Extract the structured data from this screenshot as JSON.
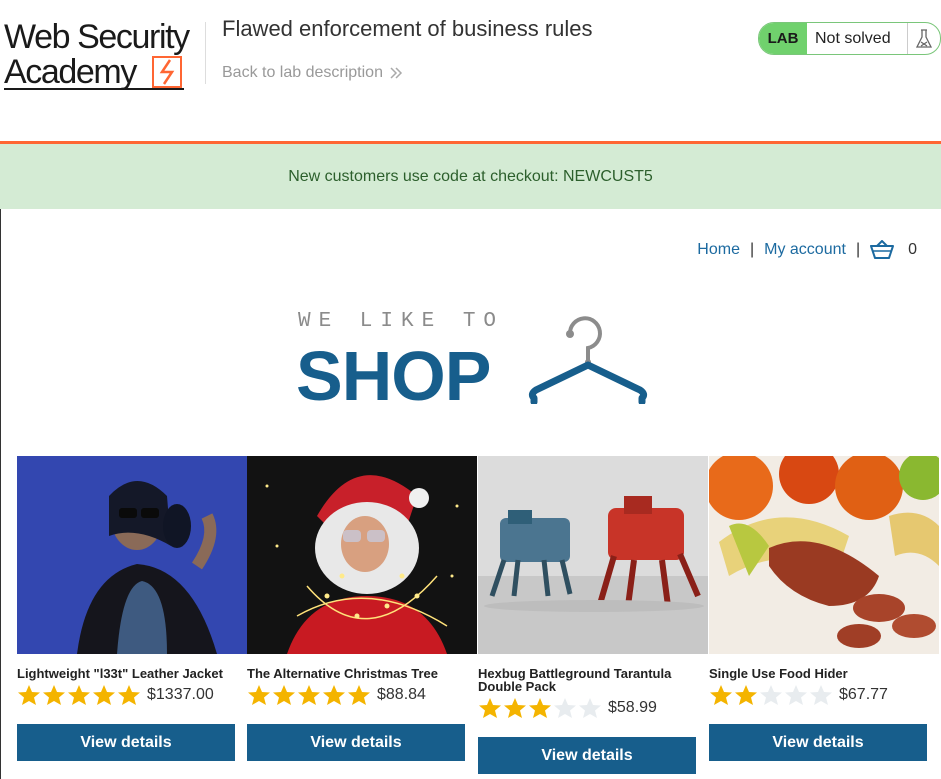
{
  "header": {
    "logo_line1": "Web Security",
    "logo_line2": "Academy",
    "lab_title": "Flawed enforcement of business rules",
    "back_link": "Back to lab description",
    "lab_badge": "LAB",
    "lab_status": "Not solved"
  },
  "banner": {
    "text": "New customers use code at checkout: NEWCUST5"
  },
  "nav": {
    "home": "Home",
    "separator": "|",
    "account": "My account",
    "cart_count": "0"
  },
  "hero": {
    "tagline": "WE LIKE TO",
    "word": "SHOP"
  },
  "products": [
    {
      "name": "Lightweight \"l33t\" Leather Jacket",
      "rating": 5,
      "price": "$1337.00",
      "button": "View details"
    },
    {
      "name": "The Alternative Christmas Tree",
      "rating": 5,
      "price": "$88.84",
      "button": "View details"
    },
    {
      "name": "Hexbug Battleground Tarantula Double Pack",
      "rating": 3,
      "price": "$58.99",
      "button": "View details"
    },
    {
      "name": "Single Use Food Hider",
      "rating": 2,
      "price": "$67.77",
      "button": "View details"
    }
  ],
  "colors": {
    "accent_orange": "#ff6633",
    "lab_green": "#70d16d",
    "banner_bg": "#d4ebd4",
    "banner_text": "#2c5f2c",
    "brand_blue": "#175e8c",
    "link_blue": "#1c6aa0",
    "star_filled": "#f4b400",
    "star_empty": "#e8ecef"
  },
  "icons": [
    "bolt-icon",
    "chevron-double-right-icon",
    "flask-icon",
    "cart-icon",
    "hanger-icon",
    "star-icon"
  ]
}
